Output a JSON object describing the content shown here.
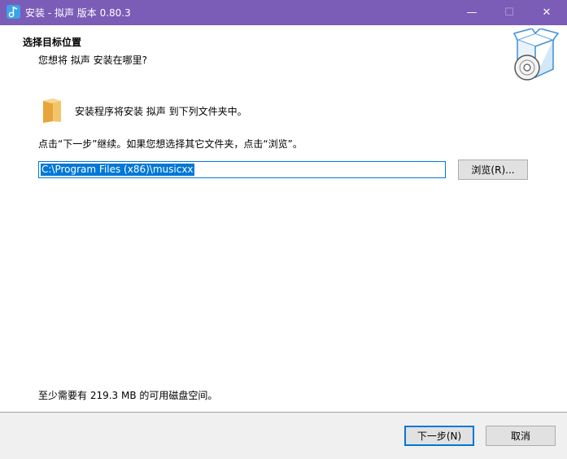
{
  "window": {
    "title": "安装 - 拟声 版本 0.80.3",
    "minimize_symbol": "—",
    "maximize_symbol": "☐",
    "close_symbol": "✕"
  },
  "header": {
    "title": "选择目标位置",
    "subtitle": "您想将 拟声 安装在哪里?"
  },
  "content": {
    "install_to_text": "安装程序将安装 拟声 到下列文件夹中。",
    "instruction_text": "点击“下一步”继续。如果您想选择其它文件夹，点击“浏览”。",
    "path_value": "C:\\Program Files (x86)\\musicxx",
    "browse_label": "浏览(R)...",
    "space_text": "至少需要有 219.3 MB 的可用磁盘空间。"
  },
  "footer": {
    "next_label": "下一步(N)",
    "cancel_label": "取消"
  },
  "icons": {
    "app": "app-music-icon",
    "header": "box-cd-icon",
    "folder": "folder-icon"
  },
  "colors": {
    "titlebar": "#7b5cb7",
    "accent": "#0078d7",
    "button_bg": "#e1e1e1",
    "footer_bg": "#f0f0f0"
  }
}
